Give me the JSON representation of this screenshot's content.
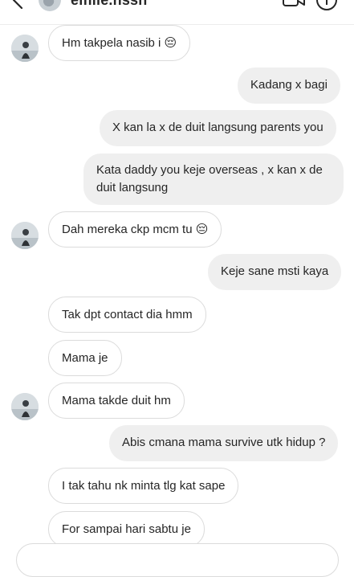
{
  "header": {
    "username": "elfilie.nssn"
  },
  "icons": {
    "back": "chevron-left-icon",
    "video": "video-camera-icon",
    "info": "info-icon"
  },
  "messages": [
    {
      "side": "in",
      "text": "Hm takpela nasib i 😔"
    },
    {
      "side": "out",
      "text": "Kadang x bagi"
    },
    {
      "side": "out",
      "text": "X kan la x de duit langsung parents you"
    },
    {
      "side": "out",
      "text": "Kata daddy you keje overseas , x kan x de duit langsung"
    },
    {
      "side": "in",
      "text": "Dah mereka ckp mcm tu 😔"
    },
    {
      "side": "out",
      "text": "Keje sane msti kaya"
    },
    {
      "side": "in",
      "text": "Tak dpt contact dia hmm"
    },
    {
      "side": "in",
      "text": "Mama je"
    },
    {
      "side": "in",
      "text": "Mama takde duit hm"
    },
    {
      "side": "out",
      "text": "Abis cmana mama survive utk hidup ?"
    },
    {
      "side": "in",
      "text": "I tak tahu nk minta tlg kat sape"
    },
    {
      "side": "in",
      "text": "For sampai hari sabtu je"
    }
  ]
}
